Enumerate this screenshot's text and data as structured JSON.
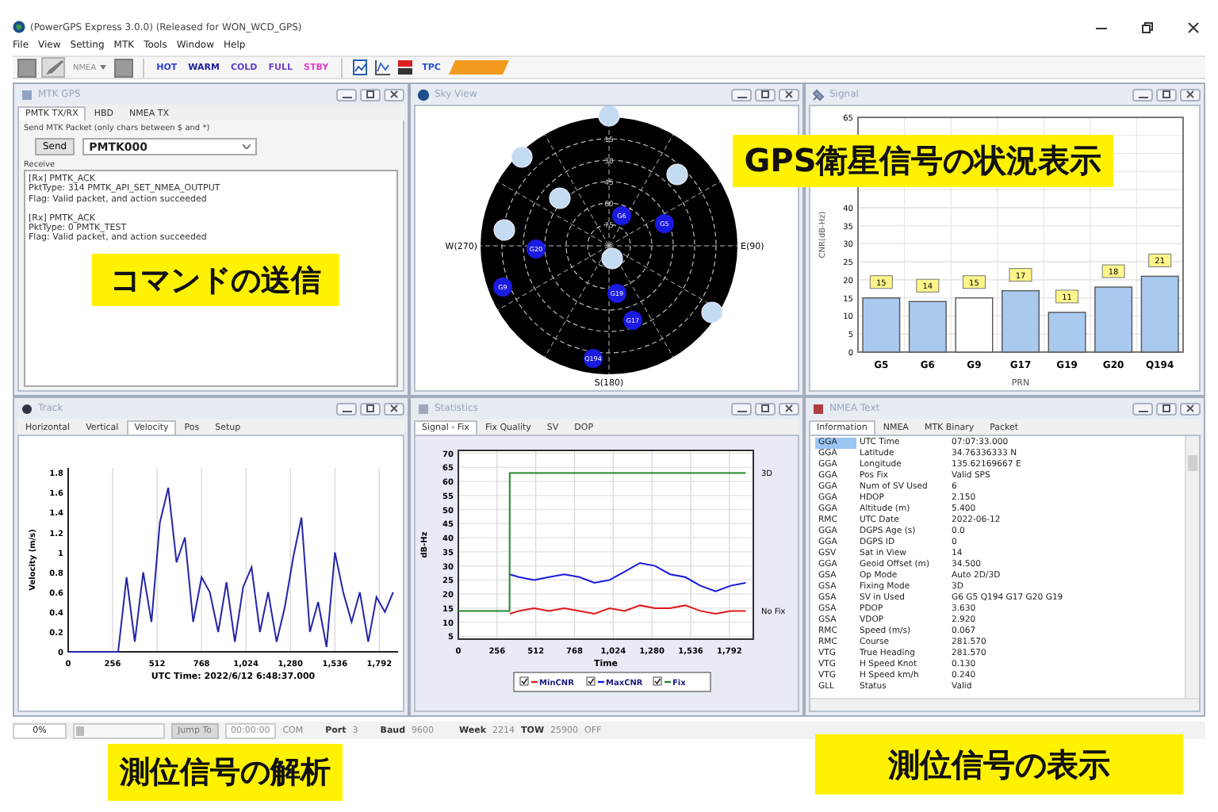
{
  "window": {
    "title": "(PowerGPS Express 3.0.0) (Released for WON_WCD_GPS)"
  },
  "menu": [
    "File",
    "View",
    "Setting",
    "MTK",
    "Tools",
    "Window",
    "Help"
  ],
  "toolbar": {
    "mode_dropdown": "NMEA",
    "restart_buttons": [
      {
        "label": "HOT",
        "color": "#2a3cd8"
      },
      {
        "label": "WARM",
        "color": "#1c1c9a"
      },
      {
        "label": "COLD",
        "color": "#5a3cc8"
      },
      {
        "label": "FULL",
        "color": "#7040d0"
      },
      {
        "label": "STBY",
        "color": "#e040c8"
      }
    ],
    "tool_label": "TPC"
  },
  "mtk_gps": {
    "title": "MTK GPS",
    "tabs": [
      {
        "label": "PMTK TX/RX",
        "selected": true
      },
      {
        "label": "HBD",
        "selected": false
      },
      {
        "label": "NMEA TX",
        "selected": false
      }
    ],
    "group_label": "Send MTK Packet (only chars between $ and *)",
    "send_button": "Send",
    "command": "PMTK000",
    "receive_label": "Receive",
    "receive_messages": [
      [
        "[Rx] PMTK_ACK",
        "PktType: 314 PMTK_API_SET_NMEA_OUTPUT",
        "Flag: Valid packet, and action succeeded"
      ],
      [
        "[Rx] PMTK_ACK",
        "PktType: 0 PMTK_TEST",
        "Flag: Valid packet, and action succeeded"
      ]
    ]
  },
  "sky_view": {
    "title": "Sky View",
    "directions": {
      "west": "W(270)",
      "east": "E(90)",
      "south": "S(180)"
    },
    "ring_labels": [
      "15",
      "30",
      "45",
      "60",
      "75"
    ],
    "satellites": [
      {
        "used": false
      },
      {
        "used": false
      },
      {
        "used": false
      },
      {
        "used": false
      },
      {
        "label": "G6",
        "used": true
      },
      {
        "label": "G5",
        "used": true
      },
      {
        "used": false
      },
      {
        "label": "G20",
        "used": true
      },
      {
        "used": false
      },
      {
        "label": "G9",
        "used": true
      },
      {
        "label": "G19",
        "used": true
      },
      {
        "used": false
      },
      {
        "label": "G17",
        "used": true
      },
      {
        "label": "Q194",
        "used": true
      }
    ]
  },
  "signal": {
    "title": "Signal",
    "used": [
      true,
      true,
      false,
      true,
      true,
      true,
      true
    ],
    "chart_data": {
      "type": "bar",
      "xlabel": "PRN",
      "ylabel": "CNR(dB-Hz)",
      "categories": [
        "G5",
        "G6",
        "G9",
        "G17",
        "G19",
        "G20",
        "Q194"
      ],
      "values": [
        15,
        14,
        15,
        17,
        11,
        18,
        21
      ],
      "ylim": [
        0,
        65
      ],
      "yticks": [
        0,
        5,
        10,
        15,
        20,
        25,
        30,
        35,
        40,
        65
      ],
      "grid": true,
      "data_labels": true
    }
  },
  "track": {
    "title": "Track",
    "tabs": [
      {
        "label": "Horizontal",
        "selected": false
      },
      {
        "label": "Vertical",
        "selected": false
      },
      {
        "label": "Velocity",
        "selected": true
      },
      {
        "label": "Pos",
        "selected": false
      },
      {
        "label": "Setup",
        "selected": false
      }
    ],
    "chart_data": {
      "type": "line",
      "xlabel": "UTC Time: 2022/6/12 6:48:37.000",
      "ylabel": "Velocity (m/s)",
      "x": [
        0,
        48,
        96,
        144,
        192,
        240,
        288,
        336,
        384,
        432,
        480,
        528,
        576,
        624,
        672,
        720,
        768,
        816,
        864,
        912,
        960,
        1008,
        1056,
        1104,
        1152,
        1200,
        1248,
        1296,
        1344,
        1392,
        1440,
        1488,
        1536,
        1584,
        1632,
        1680,
        1728,
        1776,
        1824,
        1872
      ],
      "series": [
        {
          "color": "#2424a8",
          "values": [
            0,
            0,
            0,
            0,
            0,
            0,
            0,
            0.75,
            0.1,
            0.8,
            0.3,
            1.3,
            1.65,
            0.9,
            1.15,
            0.3,
            0.75,
            0.6,
            0.2,
            0.7,
            0.1,
            0.65,
            0.85,
            0.2,
            0.6,
            0.1,
            0.45,
            0.95,
            1.35,
            0.2,
            0.5,
            0.05,
            1.0,
            0.6,
            0.3,
            0.6,
            0.1,
            0.55,
            0.4,
            0.6
          ]
        }
      ],
      "xlim": [
        0,
        1900
      ],
      "ylim": [
        0,
        1.85
      ],
      "xticks": [
        0,
        256,
        512,
        768,
        {
          "value": 1024,
          "label": "1,024"
        },
        {
          "value": 1280,
          "label": "1,280"
        },
        {
          "value": 1536,
          "label": "1,536"
        },
        {
          "value": 1792,
          "label": "1,792"
        }
      ],
      "yticks": [
        0,
        0.2,
        0.4,
        0.6,
        0.8,
        1,
        1.2,
        1.4,
        1.6,
        1.8
      ],
      "grid": true
    }
  },
  "statistics": {
    "title": "Statistics",
    "tabs": [
      {
        "label": "Signal - Fix",
        "selected": true
      },
      {
        "label": "Fix Quality",
        "selected": false
      },
      {
        "label": "SV",
        "selected": false
      },
      {
        "label": "DOP",
        "selected": false
      }
    ],
    "chart_data": {
      "type": "line",
      "xlabel": "Time",
      "ylabel": "dB-Hz",
      "x": [
        0,
        100,
        200,
        339,
        340,
        400,
        500,
        600,
        700,
        800,
        900,
        1000,
        1100,
        1200,
        1300,
        1400,
        1500,
        1600,
        1700,
        1800,
        1900
      ],
      "series": [
        {
          "name": "MinCNR",
          "color": "#e01818",
          "values": [
            null,
            null,
            null,
            null,
            13,
            14,
            15,
            14,
            15,
            14,
            13,
            15,
            14,
            16,
            15,
            15,
            16,
            14,
            13,
            14,
            14
          ]
        },
        {
          "name": "MaxCNR",
          "color": "#1818e0",
          "values": [
            null,
            null,
            null,
            null,
            27,
            26,
            25,
            26,
            27,
            26,
            24,
            25,
            28,
            31,
            30,
            27,
            26,
            23,
            21,
            23,
            24
          ]
        },
        {
          "name": "Fix",
          "color": "#1f8a2a",
          "values": [
            14,
            14,
            14,
            14,
            63,
            63,
            63,
            63,
            63,
            63,
            63,
            63,
            63,
            63,
            63,
            63,
            63,
            63,
            63,
            63,
            63
          ]
        }
      ],
      "xlim": [
        0,
        1950
      ],
      "ylim": [
        4,
        71
      ],
      "xticks": [
        0,
        256,
        512,
        768,
        {
          "value": 1024,
          "label": "1,024"
        },
        {
          "value": 1280,
          "label": "1,280"
        },
        {
          "value": 1536,
          "label": "1,536"
        },
        {
          "value": 1792,
          "label": "1,792"
        }
      ],
      "yticks": [
        5,
        10,
        15,
        20,
        25,
        30,
        35,
        40,
        45,
        50,
        55,
        60,
        65,
        70
      ],
      "annotations": [
        "3D",
        "No Fix"
      ],
      "grid": true,
      "legend": "bottom"
    },
    "legend_checked": [
      true,
      true,
      true
    ]
  },
  "nmea_text": {
    "title": "NMEA Text",
    "tabs": [
      {
        "label": "Information",
        "selected": true
      },
      {
        "label": "NMEA",
        "selected": false
      },
      {
        "label": "MTK Binary",
        "selected": false
      },
      {
        "label": "Packet",
        "selected": false
      }
    ],
    "rows": [
      {
        "type": "GGA",
        "field": "UTC Time",
        "value": "07:07:33.000",
        "selected": true
      },
      {
        "type": "GGA",
        "field": "Latitude",
        "value": "34.76336333 N",
        "selected": false
      },
      {
        "type": "GGA",
        "field": "Longitude",
        "value": "135.62169667 E",
        "selected": false
      },
      {
        "type": "GGA",
        "field": "Pos Fix",
        "value": "Valid SPS",
        "selected": false
      },
      {
        "type": "GGA",
        "field": "Num of SV Used",
        "value": "6",
        "selected": false
      },
      {
        "type": "GGA",
        "field": "HDOP",
        "value": "2.150",
        "selected": false
      },
      {
        "type": "GGA",
        "field": "Altitude (m)",
        "value": "5.400",
        "selected": false
      },
      {
        "type": "RMC",
        "field": "UTC Date",
        "value": "2022-06-12",
        "selected": false
      },
      {
        "type": "GGA",
        "field": "DGPS Age (s)",
        "value": "0.0",
        "selected": false
      },
      {
        "type": "GGA",
        "field": "DGPS ID",
        "value": "0",
        "selected": false
      },
      {
        "type": "GSV",
        "field": "Sat in View",
        "value": "14",
        "selected": false
      },
      {
        "type": "GGA",
        "field": "Geoid Offset (m)",
        "value": "34.500",
        "selected": false
      },
      {
        "type": "GSA",
        "field": "Op Mode",
        "value": "Auto 2D/3D",
        "selected": false
      },
      {
        "type": "GSA",
        "field": "Fixing Mode",
        "value": "3D",
        "selected": false
      },
      {
        "type": "GSA",
        "field": "SV in Used",
        "value": "G6 G5 Q194 G17 G20 G19",
        "selected": false
      },
      {
        "type": "GSA",
        "field": "PDOP",
        "value": "3.630",
        "selected": false
      },
      {
        "type": "GSA",
        "field": "VDOP",
        "value": "2.920",
        "selected": false
      },
      {
        "type": "RMC",
        "field": "Speed (m/s)",
        "value": "0.067",
        "selected": false
      },
      {
        "type": "RMC",
        "field": "Course",
        "value": "281.570",
        "selected": false
      },
      {
        "type": "VTG",
        "field": "True Heading",
        "value": "281.570",
        "selected": false
      },
      {
        "type": "VTG",
        "field": "H Speed Knot",
        "value": "0.130",
        "selected": false
      },
      {
        "type": "VTG",
        "field": "H Speed km/h",
        "value": "0.240",
        "selected": false
      },
      {
        "type": "GLL",
        "field": "Status",
        "value": "Valid",
        "selected": false
      }
    ]
  },
  "status_bar": {
    "progress": "0%",
    "timeline": {
      "level": 0
    },
    "jump_button": "Jump To",
    "time_field": "00:00:00",
    "com_label": "COM",
    "port_label": "Port",
    "port_value": "3",
    "baud_label": "Baud",
    "baud_value": "9600",
    "week_label": "Week",
    "week_value": "2214",
    "tow_label": "TOW",
    "tow_value": "25900",
    "gps_state": "OFF"
  },
  "callouts": [
    "GPS衛星信号の状況表示",
    "コマンドの送信",
    "測位信号の解析",
    "測位信号の表示"
  ]
}
